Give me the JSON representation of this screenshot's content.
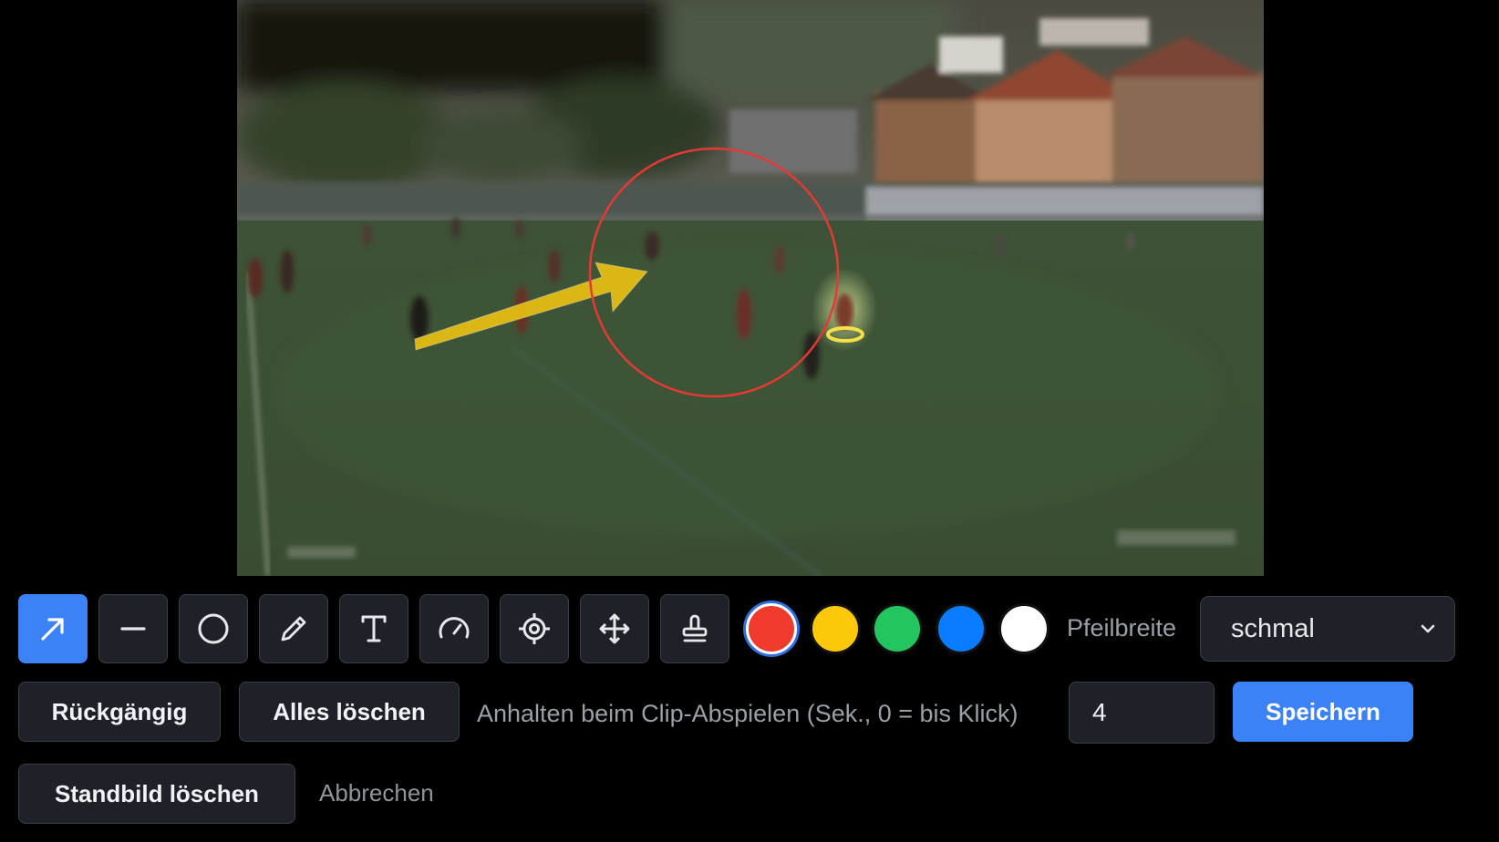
{
  "tools": [
    {
      "name": "arrow-tool",
      "icon": "arrow-up-right-icon",
      "active": true
    },
    {
      "name": "line-tool",
      "icon": "minus-icon",
      "active": false
    },
    {
      "name": "circle-tool",
      "icon": "circle-icon",
      "active": false
    },
    {
      "name": "pencil-tool",
      "icon": "pencil-icon",
      "active": false
    },
    {
      "name": "text-tool",
      "icon": "text-icon",
      "active": false
    },
    {
      "name": "speed-tool",
      "icon": "gauge-icon",
      "active": false
    },
    {
      "name": "target-tool",
      "icon": "crosshair-icon",
      "active": false
    },
    {
      "name": "move-tool",
      "icon": "move-icon",
      "active": false
    },
    {
      "name": "stamp-tool",
      "icon": "stamp-icon",
      "active": false
    }
  ],
  "colors": [
    {
      "name": "red",
      "hex": "#f03a2e",
      "selected": true
    },
    {
      "name": "yellow",
      "hex": "#fcc80a",
      "selected": false
    },
    {
      "name": "green",
      "hex": "#22c55e",
      "selected": false
    },
    {
      "name": "blue",
      "hex": "#0a7cff",
      "selected": false
    },
    {
      "name": "white",
      "hex": "#ffffff",
      "selected": false
    }
  ],
  "width_label": "Pfeilbreite",
  "width_select": {
    "value": "schmal"
  },
  "undo_label": "Rückgängig",
  "clear_all_label": "Alles löschen",
  "pause_label": "Anhalten beim Clip-Abspielen (Sek., 0 = bis Klick)",
  "pause_value": "4",
  "save_label": "Speichern",
  "delete_still_label": "Standbild löschen",
  "cancel_label": "Abbrechen",
  "annotations": {
    "arrow_color": "#e8c012",
    "circle_color": "#e53935",
    "highlight_color": "#f5e04a"
  }
}
